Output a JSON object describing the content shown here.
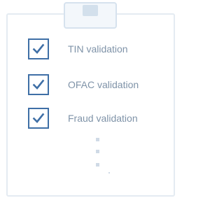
{
  "checklist": {
    "items": [
      {
        "label": "TIN validation",
        "checked": true
      },
      {
        "label": "OFAC validation",
        "checked": true
      },
      {
        "label": "Fraud validation",
        "checked": true
      }
    ],
    "more_indicator_icon": "vertical-ellipsis-icon"
  },
  "colors": {
    "accent": "#3f6fa6",
    "label_text": "#7f93a8",
    "board_border": "#e4ebf2",
    "clip_border": "#d6e2ee",
    "clip_fill": "#f3f7fb",
    "dots": "#cfdae6"
  }
}
